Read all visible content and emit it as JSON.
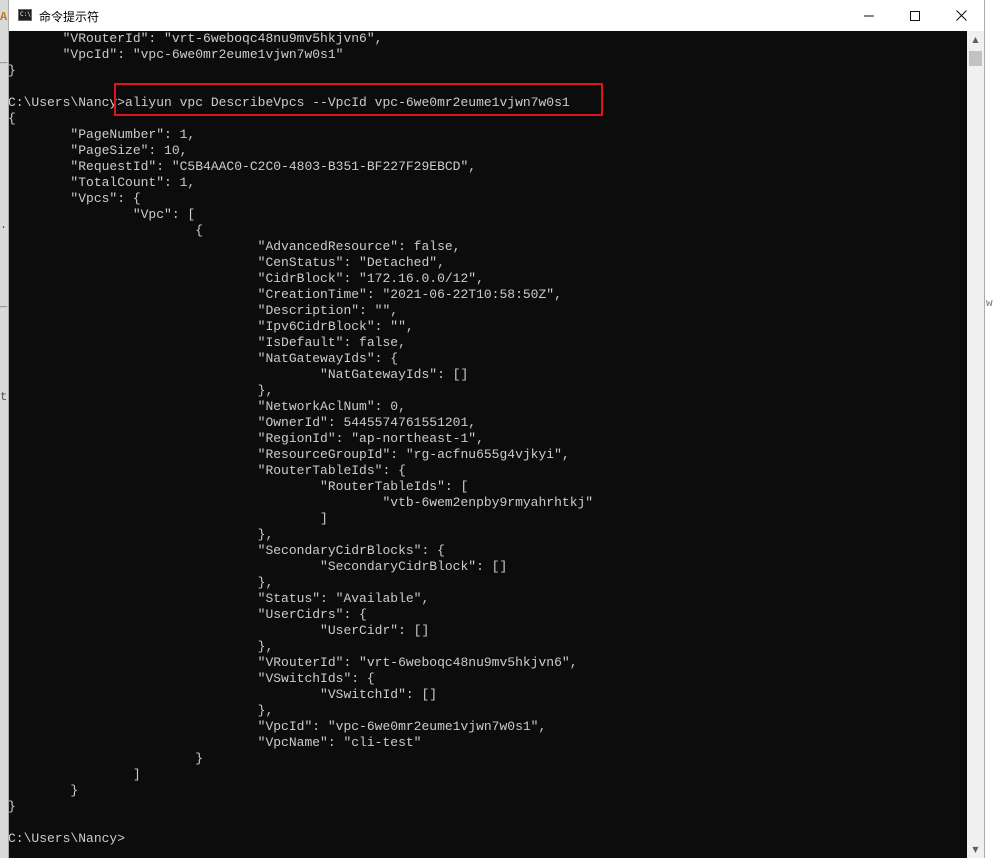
{
  "window": {
    "title": "命令提示符",
    "icon": "cmd-icon",
    "icon_label": "C:\\",
    "controls": {
      "minimize": "minimize-icon",
      "maximize": "maximize-icon",
      "close": "close-icon"
    }
  },
  "background_window_fragments": [
    "A",
    "_",
    ".v",
    "_6",
    "to"
  ],
  "right_edge_fragment": "w",
  "console": {
    "lines": [
      "       \"VRouterId\": \"vrt-6weboqc48nu9mv5hkjvn6\",",
      "       \"VpcId\": \"vpc-6we0mr2eume1vjwn7w0s1\"",
      "}",
      "",
      "C:\\Users\\Nancy>aliyun vpc DescribeVpcs --VpcId vpc-6we0mr2eume1vjwn7w0s1",
      "{",
      "        \"PageNumber\": 1,",
      "        \"PageSize\": 10,",
      "        \"RequestId\": \"C5B4AAC0-C2C0-4803-B351-BF227F29EBCD\",",
      "        \"TotalCount\": 1,",
      "        \"Vpcs\": {",
      "                \"Vpc\": [",
      "                        {",
      "                                \"AdvancedResource\": false,",
      "                                \"CenStatus\": \"Detached\",",
      "                                \"CidrBlock\": \"172.16.0.0/12\",",
      "                                \"CreationTime\": \"2021-06-22T10:58:50Z\",",
      "                                \"Description\": \"\",",
      "                                \"Ipv6CidrBlock\": \"\",",
      "                                \"IsDefault\": false,",
      "                                \"NatGatewayIds\": {",
      "                                        \"NatGatewayIds\": []",
      "                                },",
      "                                \"NetworkAclNum\": 0,",
      "                                \"OwnerId\": 5445574761551201,",
      "                                \"RegionId\": \"ap-northeast-1\",",
      "                                \"ResourceGroupId\": \"rg-acfnu655g4vjkyi\",",
      "                                \"RouterTableIds\": {",
      "                                        \"RouterTableIds\": [",
      "                                                \"vtb-6wem2enpby9rmyahrhtkj\"",
      "                                        ]",
      "                                },",
      "                                \"SecondaryCidrBlocks\": {",
      "                                        \"SecondaryCidrBlock\": []",
      "                                },",
      "                                \"Status\": \"Available\",",
      "                                \"UserCidrs\": {",
      "                                        \"UserCidr\": []",
      "                                },",
      "                                \"VRouterId\": \"vrt-6weboqc48nu9mv5hkjvn6\",",
      "                                \"VSwitchIds\": {",
      "                                        \"VSwitchId\": []",
      "                                },",
      "                                \"VpcId\": \"vpc-6we0mr2eume1vjwn7w0s1\",",
      "                                \"VpcName\": \"cli-test\"",
      "                        }",
      "                ]",
      "        }",
      "}",
      "",
      "C:\\Users\\Nancy>"
    ]
  },
  "highlight": {
    "command": "aliyun vpc DescribeVpcs --VpcId vpc-6we0mr2eume1vjwn7w0s1",
    "color": "#e0141c"
  },
  "scrollbar": {
    "up_icon": "scroll-up-arrow-icon",
    "down_icon": "scroll-down-arrow-icon"
  }
}
